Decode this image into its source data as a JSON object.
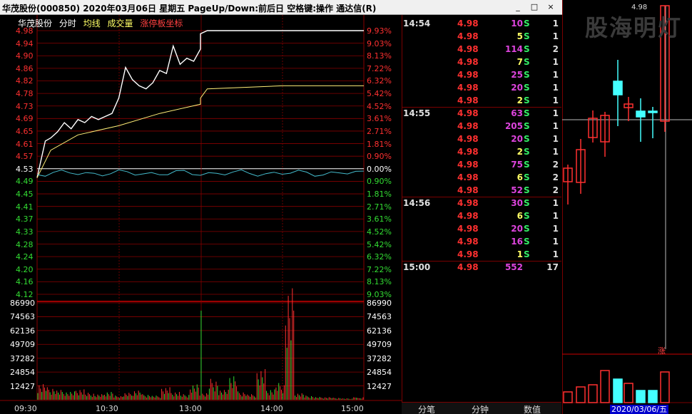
{
  "title": "华茂股份(000850)  2020年03月06日 星期五  PageUp/Down:前后日  空格键:操作  通达信(R)",
  "window_buttons": {
    "minimize": "_",
    "maximize": "□",
    "close": "×"
  },
  "legend": {
    "stock": "华茂股份",
    "view": "分时",
    "avg_line": "均线",
    "volume": "成交量",
    "limit_axis": "涨停板坐标"
  },
  "colors": {
    "up": "#ff3030",
    "down": "#33dd33",
    "price_line": "#ffffff",
    "avg_line": "#ffee77",
    "flow_line": "#44bbcc",
    "grid": "#880000",
    "volume_cyan": "#44ffff"
  },
  "chart_data": {
    "type": "line",
    "title": "",
    "prev_close": 4.53,
    "price_axis": {
      "left_labels": [
        "4.98",
        "4.94",
        "4.90",
        "4.86",
        "4.82",
        "4.78",
        "4.73",
        "4.69",
        "4.65",
        "4.61",
        "4.57",
        "4.53",
        "4.49",
        "4.45",
        "4.41",
        "4.37",
        "4.33",
        "4.28",
        "4.24",
        "4.20",
        "4.16",
        "4.12"
      ],
      "right_labels": [
        "9.93%",
        "9.03%",
        "8.13%",
        "7.22%",
        "6.32%",
        "5.42%",
        "4.52%",
        "3.61%",
        "2.71%",
        "1.81%",
        "0.90%",
        "0.00%",
        "0.90%",
        "1.81%",
        "2.71%",
        "3.61%",
        "4.52%",
        "5.42%",
        "6.32%",
        "7.22%",
        "8.13%",
        "9.03%"
      ],
      "ylim": [
        4.12,
        4.98
      ]
    },
    "volume_axis": {
      "labels": [
        "86990",
        "74563",
        "62136",
        "49709",
        "37282",
        "24854",
        "12427"
      ],
      "ylim": [
        0,
        86990
      ]
    },
    "time_labels": [
      "09:30",
      "10:30",
      "13:00",
      "14:00",
      "15:00"
    ],
    "series": [
      {
        "name": "分时",
        "x": [
          "09:30",
          "09:33",
          "09:36",
          "09:40",
          "09:45",
          "09:50",
          "09:55",
          "10:00",
          "10:05",
          "10:10",
          "10:15",
          "10:20",
          "10:25",
          "10:30",
          "10:35",
          "10:40",
          "10:45",
          "10:50",
          "10:55",
          "11:00",
          "11:05",
          "11:10",
          "11:15",
          "11:20",
          "11:25",
          "11:30",
          "13:00",
          "13:05",
          "13:30",
          "14:00",
          "14:30",
          "15:00"
        ],
        "values": [
          4.5,
          4.56,
          4.62,
          4.63,
          4.65,
          4.68,
          4.66,
          4.69,
          4.68,
          4.7,
          4.69,
          4.7,
          4.71,
          4.76,
          4.86,
          4.82,
          4.8,
          4.79,
          4.81,
          4.85,
          4.84,
          4.93,
          4.87,
          4.89,
          4.88,
          4.92,
          4.97,
          4.98,
          4.98,
          4.98,
          4.98,
          4.98
        ]
      },
      {
        "name": "均线",
        "x": [
          "09:30",
          "09:40",
          "10:00",
          "10:30",
          "11:00",
          "11:30",
          "13:00",
          "13:05",
          "14:00",
          "15:00"
        ],
        "values": [
          4.5,
          4.59,
          4.64,
          4.67,
          4.71,
          4.74,
          4.76,
          4.79,
          4.8,
          4.8
        ]
      }
    ],
    "volume_bars_sample": [
      12000,
      9000,
      7000,
      6000,
      8000,
      5000,
      4000,
      6000,
      3000,
      5000,
      7000,
      4000,
      3000,
      9000,
      6000,
      4000,
      11000,
      5000,
      15000,
      7000,
      18000,
      6000,
      4000,
      22000,
      8000,
      12000,
      80000,
      5000,
      3000,
      2000,
      2000,
      1500,
      1000
    ],
    "kline_top_price": "4.98"
  },
  "trades": [
    {
      "time": "14:54",
      "price": "4.98",
      "volume": "10",
      "side": "S",
      "count": "1",
      "vol_color": "#dd44dd"
    },
    {
      "time": "",
      "price": "4.98",
      "volume": "5",
      "side": "S",
      "count": "1",
      "vol_color": "#ffff66"
    },
    {
      "time": "",
      "price": "4.98",
      "volume": "114",
      "side": "S",
      "count": "2",
      "vol_color": "#dd44dd"
    },
    {
      "time": "",
      "price": "4.98",
      "volume": "7",
      "side": "S",
      "count": "1",
      "vol_color": "#ffff66"
    },
    {
      "time": "",
      "price": "4.98",
      "volume": "25",
      "side": "S",
      "count": "1",
      "vol_color": "#dd44dd"
    },
    {
      "time": "",
      "price": "4.98",
      "volume": "20",
      "side": "S",
      "count": "1",
      "vol_color": "#dd44dd"
    },
    {
      "time": "",
      "price": "4.98",
      "volume": "2",
      "side": "S",
      "count": "1",
      "vol_color": "#ffff66"
    },
    {
      "time": "14:55",
      "price": "4.98",
      "volume": "63",
      "side": "S",
      "count": "1",
      "vol_color": "#dd44dd"
    },
    {
      "time": "",
      "price": "4.98",
      "volume": "205",
      "side": "S",
      "count": "1",
      "vol_color": "#dd44dd"
    },
    {
      "time": "",
      "price": "4.98",
      "volume": "20",
      "side": "S",
      "count": "1",
      "vol_color": "#dd44dd"
    },
    {
      "time": "",
      "price": "4.98",
      "volume": "2",
      "side": "S",
      "count": "1",
      "vol_color": "#ffff66"
    },
    {
      "time": "",
      "price": "4.98",
      "volume": "75",
      "side": "S",
      "count": "2",
      "vol_color": "#dd44dd"
    },
    {
      "time": "",
      "price": "4.98",
      "volume": "6",
      "side": "S",
      "count": "2",
      "vol_color": "#ffff66"
    },
    {
      "time": "",
      "price": "4.98",
      "volume": "52",
      "side": "S",
      "count": "2",
      "vol_color": "#dd44dd"
    },
    {
      "time": "14:56",
      "price": "4.98",
      "volume": "30",
      "side": "S",
      "count": "1",
      "vol_color": "#dd44dd"
    },
    {
      "time": "",
      "price": "4.98",
      "volume": "6",
      "side": "S",
      "count": "1",
      "vol_color": "#ffff66"
    },
    {
      "time": "",
      "price": "4.98",
      "volume": "20",
      "side": "S",
      "count": "1",
      "vol_color": "#dd44dd"
    },
    {
      "time": "",
      "price": "4.98",
      "volume": "16",
      "side": "S",
      "count": "1",
      "vol_color": "#dd44dd"
    },
    {
      "time": "",
      "price": "4.98",
      "volume": "1",
      "side": "S",
      "count": "1",
      "vol_color": "#ffff66"
    },
    {
      "time": "15:00",
      "price": "4.98",
      "volume": "552",
      "side": "",
      "count": "17",
      "vol_color": "#dd44dd"
    }
  ],
  "tabs": {
    "trades": "分笔",
    "minutes": "分钟",
    "values": "数值"
  },
  "watermark": "股海明灯",
  "rise_mark": "涨",
  "date_label": "2020/03/06/五"
}
